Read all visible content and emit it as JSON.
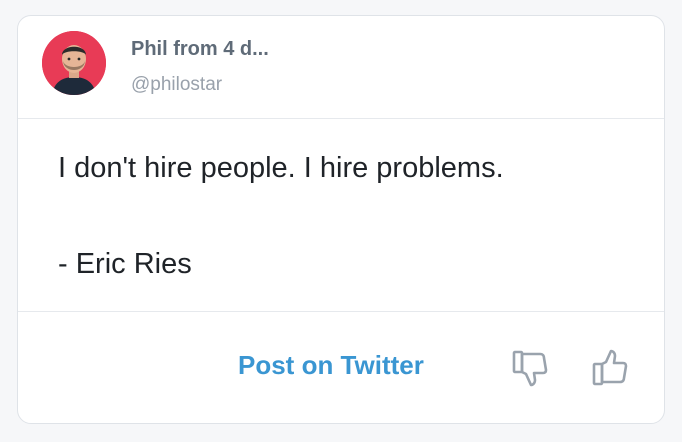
{
  "author": {
    "name": "Phil from 4 d...",
    "handle": "@philostar"
  },
  "quote": {
    "line1": "I don't hire people. I hire problems.",
    "line2": "- Eric Ries"
  },
  "actions": {
    "post_label": "Post on Twitter",
    "dislike_icon": "thumbs-down-icon",
    "like_icon": "thumbs-up-icon"
  },
  "colors": {
    "accent": "#3a96d2",
    "avatar_bg": "#e83b56",
    "name": "#5f6b78",
    "handle": "#99a1ab",
    "text": "#1f2328",
    "icon": "#9aa3ad"
  }
}
